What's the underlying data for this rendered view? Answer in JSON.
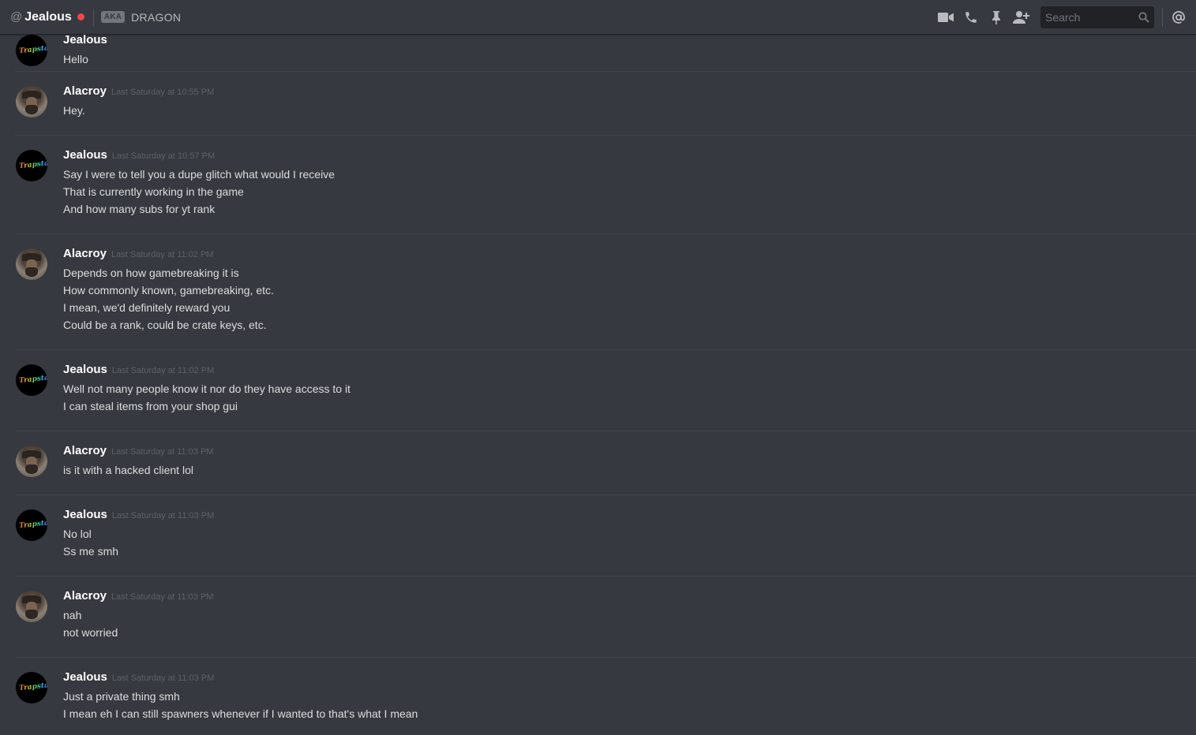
{
  "header": {
    "at_symbol": "@",
    "dm_name": "Jealous",
    "status_color": "#f04747",
    "aka_badge": "AKA",
    "aka_name": "DRAGON",
    "search": {
      "placeholder": "Search",
      "value": ""
    },
    "icons": [
      "video-call-icon",
      "voice-call-icon",
      "pin-icon",
      "add-friend-icon",
      "search-icon",
      "mention-icon"
    ]
  },
  "messages": [
    {
      "author": "Jealous",
      "avatar": "jealous",
      "avatar_text": "Trapstar",
      "timestamp": "",
      "lines": [
        "Hello"
      ]
    },
    {
      "author": "Alacroy",
      "avatar": "alacroy",
      "timestamp": "Last Saturday at 10:55 PM",
      "lines": [
        "Hey."
      ]
    },
    {
      "author": "Jealous",
      "avatar": "jealous",
      "avatar_text": "Trapstar",
      "timestamp": "Last Saturday at 10:57 PM",
      "lines": [
        "Say I were to tell you a dupe glitch what would I receive",
        "That is currently working in the game",
        "And how many subs for yt rank"
      ]
    },
    {
      "author": "Alacroy",
      "avatar": "alacroy",
      "timestamp": "Last Saturday at 11:02 PM",
      "lines": [
        "Depends on how gamebreaking it is",
        "How commonly known, gamebreaking, etc.",
        "I mean, we'd definitely reward you",
        "Could be a rank, could be crate keys, etc."
      ]
    },
    {
      "author": "Jealous",
      "avatar": "jealous",
      "avatar_text": "Trapstar",
      "timestamp": "Last Saturday at 11:02 PM",
      "lines": [
        "Well not many people know it nor do they have access to it",
        "I can steal items from your shop gui"
      ]
    },
    {
      "author": "Alacroy",
      "avatar": "alacroy",
      "timestamp": "Last Saturday at 11:03 PM",
      "lines": [
        "is it with a hacked client lol"
      ]
    },
    {
      "author": "Jealous",
      "avatar": "jealous",
      "avatar_text": "Trapstar",
      "timestamp": "Last Saturday at 11:03 PM",
      "lines": [
        "No lol",
        "Ss me smh"
      ]
    },
    {
      "author": "Alacroy",
      "avatar": "alacroy",
      "timestamp": "Last Saturday at 11:03 PM",
      "lines": [
        "nah",
        "not worried"
      ]
    },
    {
      "author": "Jealous",
      "avatar": "jealous",
      "avatar_text": "Trapstar",
      "timestamp": "Last Saturday at 11:03 PM",
      "lines": [
        "Just a private thing smh",
        "I mean eh I can still spawners whenever if I wanted to that's what I mean"
      ]
    }
  ]
}
